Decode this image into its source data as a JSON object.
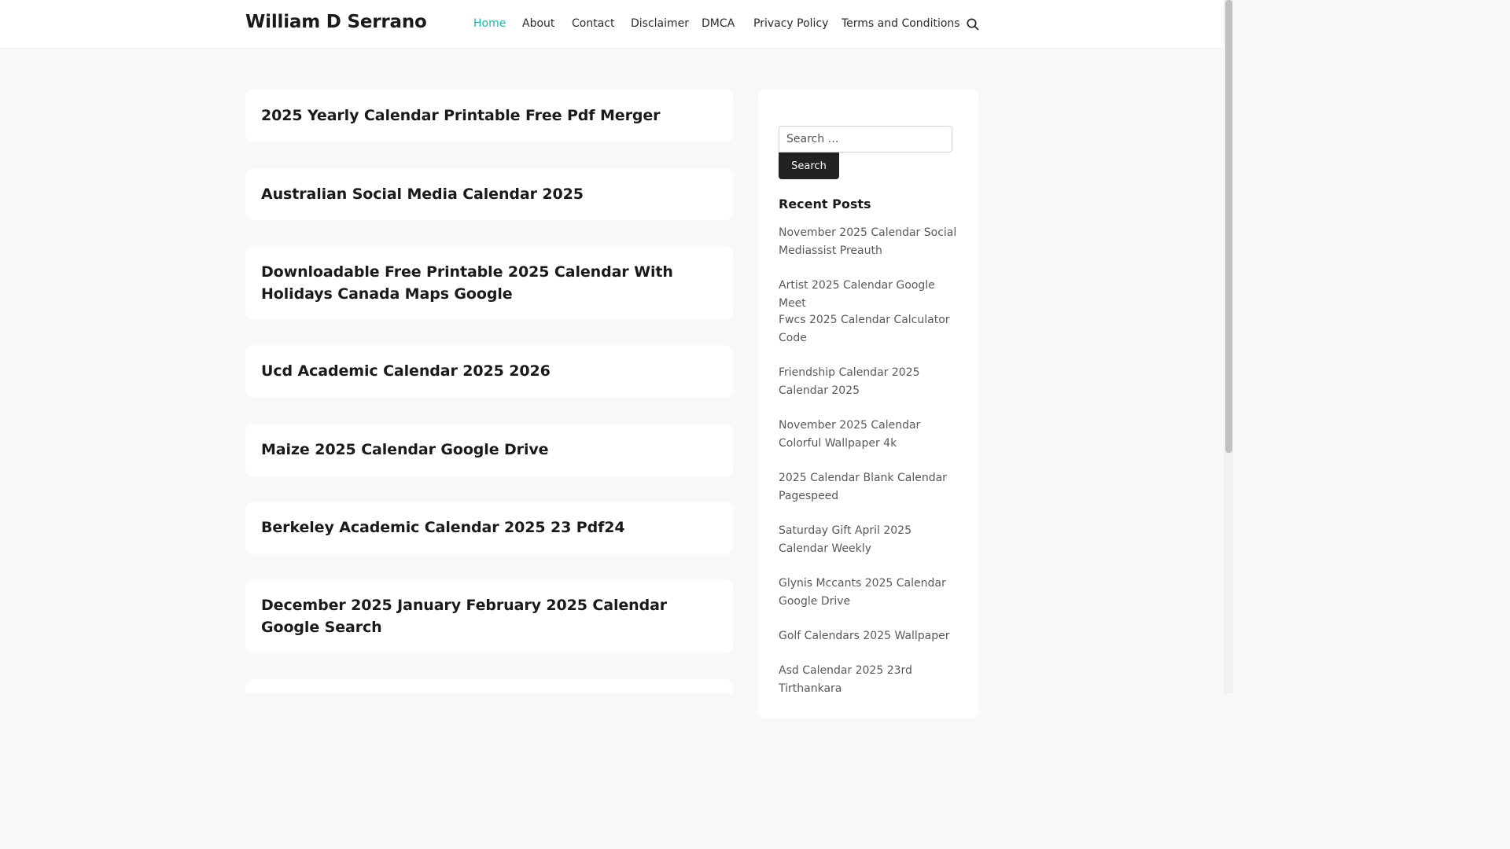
{
  "site": {
    "title": "William D Serrano"
  },
  "nav": {
    "items": [
      {
        "label": "Home",
        "active": true
      },
      {
        "label": "About"
      },
      {
        "label": "Contact"
      },
      {
        "label": "Disclaimer"
      },
      {
        "label": "DMCA"
      },
      {
        "label": "Privacy Policy"
      },
      {
        "label": "Terms and Conditions"
      }
    ],
    "search_icon": "search-icon"
  },
  "posts": [
    {
      "title": "2025 Yearly Calendar Printable Free Pdf Merger"
    },
    {
      "title": "Australian Social Media Calendar 2025"
    },
    {
      "title": "Downloadable Free Printable 2025 Calendar With Holidays Canada Maps Google"
    },
    {
      "title": "Ucd Academic Calendar 2025 2026"
    },
    {
      "title": "Maize 2025 Calendar Google Drive"
    },
    {
      "title": "Berkeley Academic Calendar 2025 23 Pdf24"
    },
    {
      "title": "December 2025 January February 2025 Calendar Google Search"
    },
    {
      "title": ""
    }
  ],
  "sidebar": {
    "search": {
      "placeholder": "Search …",
      "value": "",
      "button_label": "Search"
    },
    "recent_posts": {
      "title": "Recent Posts",
      "items": [
        "November 2025 Calendar Social Mediassist Preauth",
        "Artist 2025 Calendar Google Meet",
        "Fwcs 2025 Calendar Calculator Code",
        "Friendship Calendar 2025 Calendar 2025",
        "November 2025 Calendar Colorful Wallpaper 4k",
        "2025 Calendar Blank Calendar Pagespeed",
        "Saturday Gift April 2025 Calendar Weekly",
        "Glynis Mccants 2025 Calendar Google Drive",
        "Golf Calendars 2025 Wallpaper",
        "Asd Calendar 2025 23rd Tirthankara"
      ]
    }
  },
  "colors": {
    "accent": "#1fb3a8",
    "background": "#f7f8f9",
    "card": "#ffffff",
    "button": "#222222"
  }
}
